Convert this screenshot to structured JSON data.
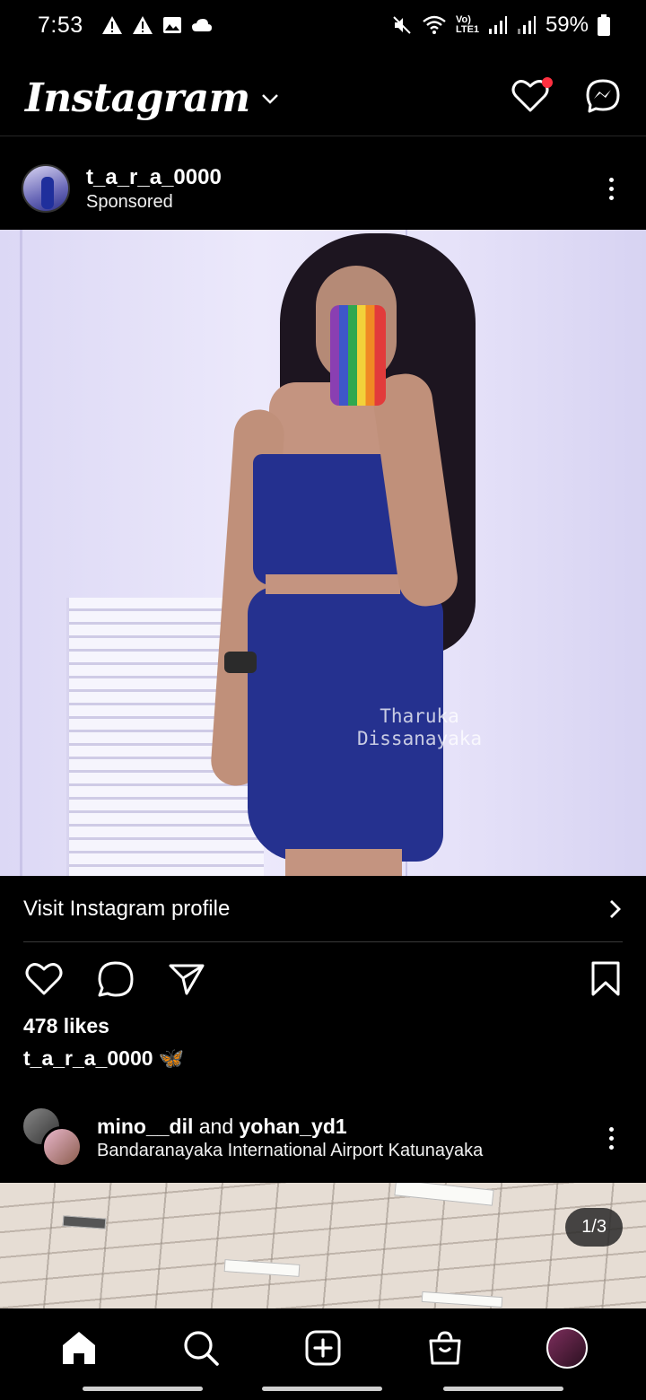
{
  "status_bar": {
    "time": "7:53",
    "battery": "59%",
    "network_label": "Vo) LTE1"
  },
  "header": {
    "logo": "Instagram"
  },
  "post1": {
    "username": "t_a_r_a_0000",
    "subtitle": "Sponsored",
    "watermark_line1": "Tharuka",
    "watermark_line2": "Dissanayaka",
    "visit_label": "Visit Instagram profile",
    "likes": "478 likes",
    "caption_user": "t_a_r_a_0000",
    "caption_emoji": "🦋"
  },
  "post2": {
    "user1": "mino__dil",
    "and": "and",
    "user2": "yohan_yd1",
    "location": "Bandaranayaka International Airport Katunayaka",
    "counter": "1/3"
  },
  "colors": {
    "background": "#000000",
    "notification_dot": "#ff3040",
    "dress": "#25318f"
  }
}
